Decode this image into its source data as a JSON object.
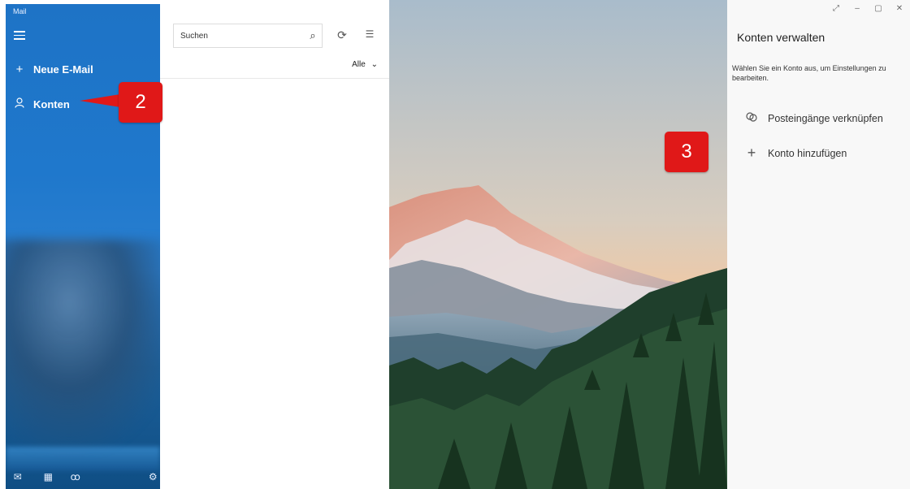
{
  "app": {
    "title": "Mail"
  },
  "nav": {
    "menu_icon": "hamburger-icon",
    "new_mail": {
      "icon": "+",
      "label": "Neue E-Mail"
    },
    "accounts": {
      "icon": "person-icon",
      "label": "Konten"
    },
    "bottom": [
      "mail-icon",
      "calendar-icon",
      "people-icon",
      "settings-icon"
    ]
  },
  "list": {
    "search_placeholder": "Suchen",
    "filter_label": "Alle",
    "tools": [
      "sync-icon",
      "select-icon"
    ]
  },
  "panel": {
    "title": "Konten verwalten",
    "description": "Wählen Sie ein Konto aus, um Einstellungen zu bearbeiten.",
    "items": [
      {
        "icon": "link-icon",
        "label": "Posteingänge verknüpfen"
      },
      {
        "icon": "plus-icon",
        "label": "Konto hinzufügen"
      }
    ]
  },
  "annotations": [
    {
      "number": "2"
    },
    {
      "number": "3"
    }
  ],
  "colors": {
    "nav": "#1f78cc",
    "callout": "#e01818",
    "panel": "#f8f8f8"
  }
}
